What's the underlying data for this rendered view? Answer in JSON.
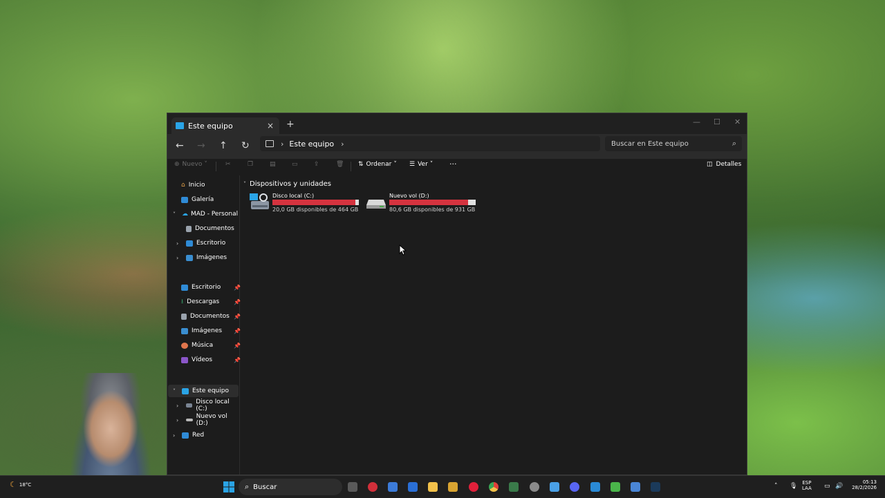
{
  "window": {
    "tab_title": "Este equipo",
    "new_tab": "+",
    "close_tab": "×"
  },
  "address": {
    "breadcrumb": "Este equipo",
    "search_placeholder": "Buscar en Este equipo"
  },
  "toolbar": {
    "new_label": "Nuevo",
    "sort_label": "Ordenar",
    "view_label": "Ver",
    "more_label": "···",
    "details_label": "Detalles"
  },
  "sidebar": {
    "home": "Inicio",
    "gallery": "Galería",
    "onedrive": "MAD - Personal",
    "od_documents": "Documentos",
    "od_desktop": "Escritorio",
    "od_images": "Imágenes",
    "quick": [
      {
        "label": "Escritorio",
        "color": "#2f8bd6"
      },
      {
        "label": "Descargas",
        "color": "#35a36a"
      },
      {
        "label": "Documentos",
        "color": "#9aa3ad"
      },
      {
        "label": "Imágenes",
        "color": "#3a8ed0"
      },
      {
        "label": "Música",
        "color": "#e0764d"
      },
      {
        "label": "Vídeos",
        "color": "#8b56c9"
      }
    ],
    "this_pc": "Este equipo",
    "disk_c": "Disco local (C:)",
    "disk_d": "Nuevo vol (D:)",
    "network": "Red"
  },
  "content": {
    "group_label": "Dispositivos y unidades",
    "drives": [
      {
        "name": "Disco local (C:)",
        "free_text": "20,0 GB disponibles de 464 GB",
        "used_fraction": 0.957
      },
      {
        "name": "Nuevo vol (D:)",
        "free_text": "80,6 GB disponibles de 931 GB",
        "used_fraction": 0.913
      }
    ]
  },
  "taskbar": {
    "weather": "18°C",
    "search_label": "Buscar",
    "lang_top": "ESP",
    "lang_bottom": "LAA",
    "time": "05:13",
    "date": "28/2/2026"
  },
  "colors": {
    "accent": "#2aa4e6",
    "disk_used": "#d5333f"
  }
}
